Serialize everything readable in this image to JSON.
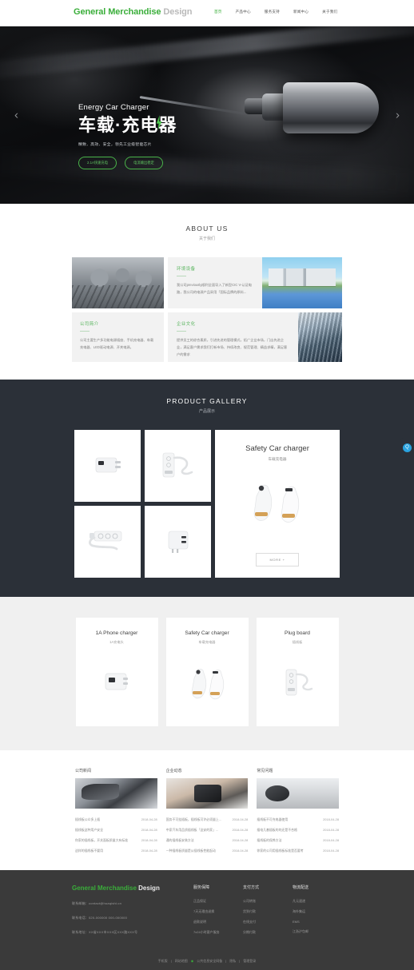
{
  "header": {
    "brand_main": "General Merchandise",
    "brand_sub": "Design",
    "nav": [
      {
        "label": "首页",
        "active": true
      },
      {
        "label": "产品中心",
        "active": false
      },
      {
        "label": "服务支持",
        "active": false
      },
      {
        "label": "新闻中心",
        "active": false
      },
      {
        "label": "关于我们",
        "active": false
      }
    ]
  },
  "hero": {
    "eyebrow": "Energy Car Charger",
    "title_part1": "车载",
    "title_dot": "·",
    "title_part2": "充电器",
    "subtitle": "精致、高效、安全，领先工业级智能芯片",
    "btn1": "2.1A快速充电",
    "btn2": "电流输出稳定",
    "prev": "‹",
    "next": "›"
  },
  "about": {
    "title": "ABOUT US",
    "subtitle": "关于我们",
    "cards": [
      {
        "heading": "环境设备",
        "text": "我公司previously顺利全面导入了新型CIC V-认证电路，我公司的电源产品采用「国际品牌的原料..."
      },
      {
        "heading": "公司简介",
        "text": "公司主要生产多功能电源插座、手机充电器、车载充电器、LED驱动电源、开关电源。"
      },
      {
        "heading": "企业文化",
        "text": "提供员工的综合素质，引进先进的管理模式，拓广企业市场，门店先进企业，满足客户需求我们打新市场、持续改良、规范管理、精益求精，满足客户的需求"
      }
    ]
  },
  "gallery": {
    "title": "PRODUCT GALLERY",
    "subtitle": "产品展示",
    "feature": {
      "heading": "Safety Car charger",
      "subheading": "车载充电器",
      "more_label": "MORE +"
    },
    "thumbs": [
      {
        "name": "白色电源适配器"
      },
      {
        "name": "插线板带线"
      },
      {
        "name": "三孔插线板"
      },
      {
        "name": "双USB充电头"
      }
    ]
  },
  "products": [
    {
      "heading": "1A Phone charger",
      "subheading": "1A充电头"
    },
    {
      "heading": "Safety Car charger",
      "subheading": "车载充电器"
    },
    {
      "heading": "Plug board",
      "subheading": "插线板"
    }
  ],
  "news": {
    "columns": [
      {
        "heading": "公司新闻",
        "items": [
          {
            "title": "插线板公众多上插",
            "date": "2018-04-28"
          },
          {
            "title": "插线板这种用户安全",
            "date": "2018-04-28"
          },
          {
            "title": "你家的插线板，开关面板质量大有标准",
            "date": "2018-04-28"
          },
          {
            "title": "这样的插线板不要用",
            "date": "2018-04-28"
          }
        ]
      },
      {
        "heading": "企业动态",
        "items": [
          {
            "title": "国务不可挂插板，插线板可许必须量上...",
            "date": "2018-04-28"
          },
          {
            "title": "中家汽车用品质插线板「这安的家」...",
            "date": "2018-04-28"
          },
          {
            "title": "通的插线板安装方法",
            "date": "2018-04-28"
          },
          {
            "title": "一种插线板质量是从插线板性能起动",
            "date": "2018-04-28"
          }
        ]
      },
      {
        "heading": "常见问题",
        "items": [
          {
            "title": "插线板不可充电器使用",
            "date": "2018-04-28"
          },
          {
            "title": "插电几基插板的的还是不合格",
            "date": "2018-04-28"
          },
          {
            "title": "插线板的保养方法",
            "date": "2018-04-28"
          },
          {
            "title": "你家的公司用插线板标准是否要考",
            "date": "2018-04-28"
          }
        ]
      }
    ]
  },
  "footer": {
    "brand_main": "General Merchandise",
    "brand_sub": "Design",
    "contacts": [
      "联系邮箱：contact@huaqishi.cn",
      "联系电话：020-000000  000-000000",
      "联系地址：XX省XXX市XXX区XXX路XXX号"
    ],
    "columns": [
      {
        "heading": "服务保障",
        "items": [
          "正品保证",
          "7天无理由退换",
          "退款说明",
          "7x24小时客户服务"
        ]
      },
      {
        "heading": "支付方式",
        "items": [
          "公司转账",
          "货到付款",
          "在线支付",
          "分期付款"
        ]
      },
      {
        "heading": "物流配送",
        "items": [
          "凡元速递",
          "海外集运",
          "EMS",
          "江浙沪包邮"
        ]
      }
    ],
    "bar": [
      "手机版",
      "网站地图",
      "公共信息安全网备",
      "隐私",
      "管理登录"
    ]
  },
  "float_widget": {
    "icon": "Q"
  }
}
